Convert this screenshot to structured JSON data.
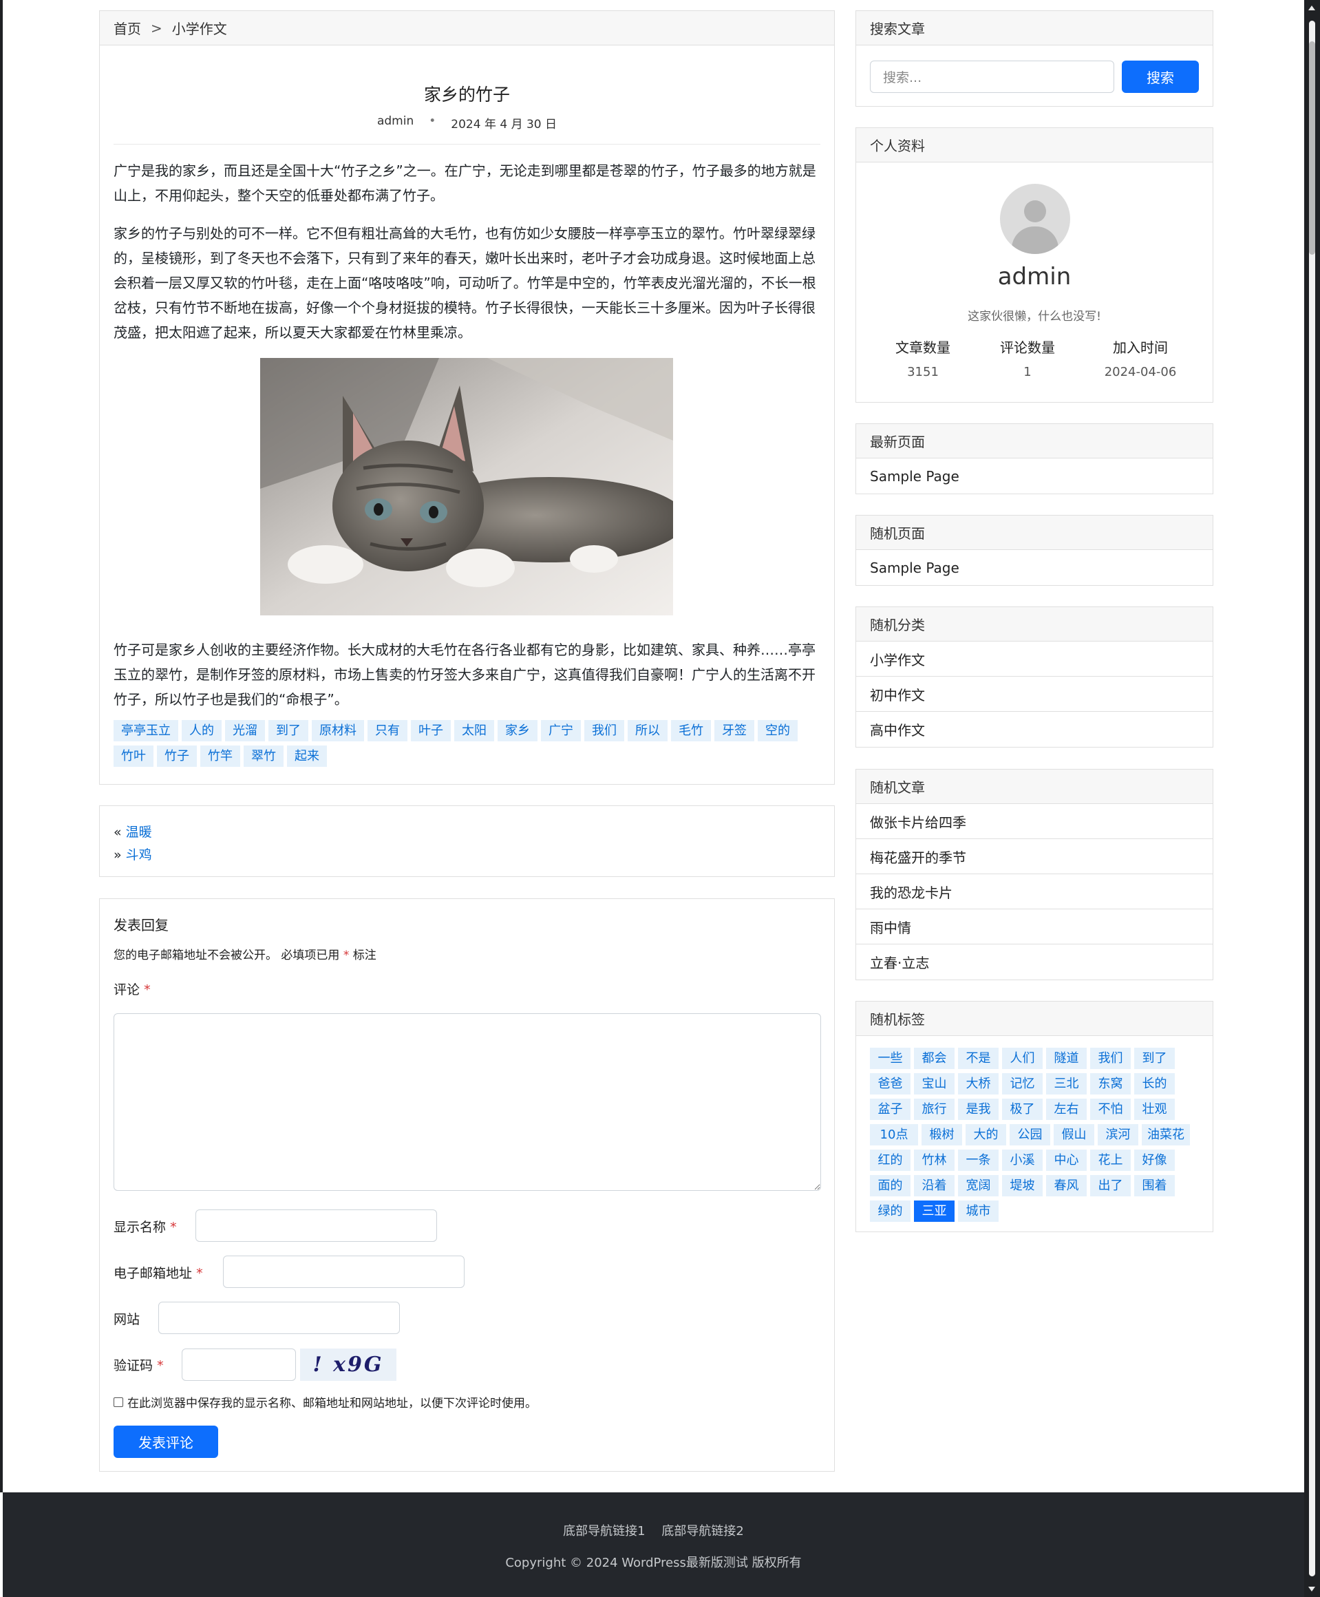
{
  "breadcrumb": {
    "home": "首页",
    "separator": ">",
    "category": "小学作文"
  },
  "post": {
    "title": "家乡的竹子",
    "author": "admin",
    "date": "2024 年 4 月 30 日",
    "paragraphs": [
      "广宁是我的家乡，而且还是全国十大“竹子之乡”之一。在广宁，无论走到哪里都是苍翠的竹子，竹子最多的地方就是山上，不用仰起头，整个天空的低垂处都布满了竹子。",
      "家乡的竹子与别处的可不一样。它不但有粗壮高耸的大毛竹，也有仿如少女腰肢一样亭亭玉立的翠竹。竹叶翠绿翠绿的，呈棱镜形，到了冬天也不会落下，只有到了来年的春天，嫩叶长出来时，老叶子才会功成身退。这时候地面上总会积着一层又厚又软的竹叶毯，走在上面“咯吱咯吱”响，可动听了。竹竿是中空的，竹竿表皮光溜光溜的，不长一根岔枝，只有竹节不断地在拔高，好像一个个身材挺拔的模特。竹子长得很快，一天能长三十多厘米。因为叶子长得很茂盛，把太阳遮了起来，所以夏天大家都爱在竹林里乘凉。",
      "竹子可是家乡人创收的主要经济作物。长大成材的大毛竹在各行各业都有它的身影，比如建筑、家具、种养……亭亭玉立的翠竹，是制作牙签的原材料，市场上售卖的竹牙签大多来自广宁，这真值得我们自豪啊！广宁人的生活离不开竹子，所以竹子也是我们的“命根子”。"
    ],
    "tags": [
      "亭亭玉立",
      "人的",
      "光溜",
      "到了",
      "原材料",
      "只有",
      "叶子",
      "太阳",
      "家乡",
      "广宁",
      "我们",
      "所以",
      "毛竹",
      "牙签",
      "空的",
      "竹叶",
      "竹子",
      "竹竿",
      "翠竹",
      "起来"
    ]
  },
  "nav": {
    "prev_symbol": "«",
    "prev_title": "温暖",
    "next_symbol": "»",
    "next_title": "斗鸡"
  },
  "reply": {
    "title": "发表回复",
    "note_prefix": "您的电子邮箱地址不会被公开。 必填项已用",
    "note_star": "*",
    "note_suffix": "标注",
    "comment_label": "评论",
    "name_label": "显示名称",
    "email_label": "电子邮箱地址",
    "website_label": "网站",
    "captcha_label": "验证码",
    "captcha_text": "! x9G",
    "remember_text": "在此浏览器中保存我的显示名称、邮箱地址和网站地址，以便下次评论时使用。",
    "submit_label": "发表评论"
  },
  "sidebar": {
    "search": {
      "title": "搜索文章",
      "placeholder": "搜索...",
      "button": "搜索"
    },
    "profile": {
      "title": "个人资料",
      "name": "admin",
      "bio": "这家伙很懒，什么也没写!",
      "stats": [
        {
          "label": "文章数量",
          "value": "3151"
        },
        {
          "label": "评论数量",
          "value": "1"
        },
        {
          "label": "加入时间",
          "value": "2024-04-06"
        }
      ]
    },
    "latest_pages": {
      "title": "最新页面",
      "items": [
        "Sample Page"
      ]
    },
    "random_pages": {
      "title": "随机页面",
      "items": [
        "Sample Page"
      ]
    },
    "random_categories": {
      "title": "随机分类",
      "items": [
        "小学作文",
        "初中作文",
        "高中作文"
      ]
    },
    "random_posts": {
      "title": "随机文章",
      "items": [
        "做张卡片给四季",
        "梅花盛开的季节",
        "我的恐龙卡片",
        "雨中情",
        "立春·立志"
      ]
    },
    "random_tags": {
      "title": "随机标签",
      "active": "三亚",
      "items": [
        "一些",
        "都会",
        "不是",
        "人们",
        "隧道",
        "我们",
        "到了",
        "爸爸",
        "宝山",
        "大桥",
        "记忆",
        "三北",
        "东窝",
        "长的",
        "盆子",
        "旅行",
        "是我",
        "极了",
        "左右",
        "不怕",
        "壮观",
        "10点",
        "椴树",
        "大的",
        "公园",
        "假山",
        "滨河",
        "油菜花",
        "红的",
        "竹林",
        "一条",
        "小溪",
        "中心",
        "花上",
        "好像",
        "面的",
        "沿着",
        "宽阔",
        "堤坡",
        "春风",
        "出了",
        "围着",
        "绿的",
        "三亚",
        "城市"
      ]
    }
  },
  "footer": {
    "links": [
      "底部导航链接1",
      "底部导航链接2"
    ],
    "copyright": "Copyright © 2024 WordPress最新版测试 版权所有"
  }
}
